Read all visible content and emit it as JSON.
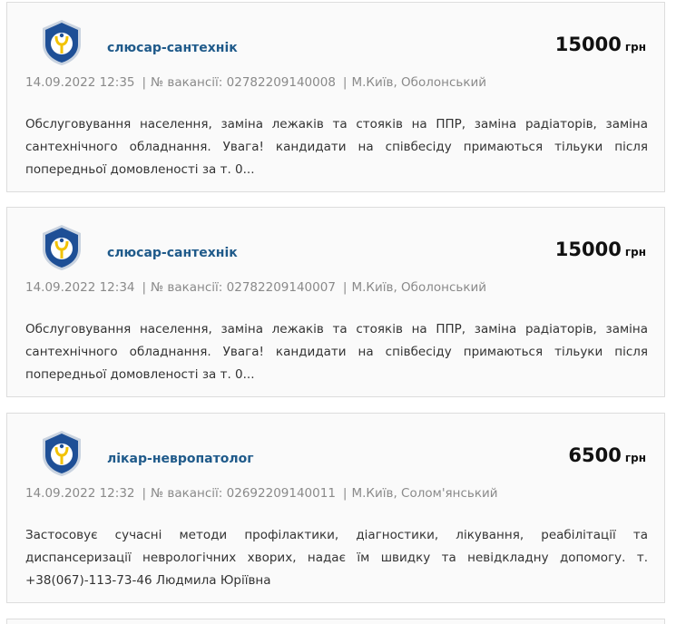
{
  "vacancies": [
    {
      "title": "слюсар-сантехнік",
      "salary": "15000",
      "currency": "грн",
      "date": "14.09.2022 12:35",
      "vacancy_label": "№ вакансії:",
      "vacancy_no": "02782209140008",
      "location": "М.Київ, Оболонський",
      "description": "Обслуговування населення, заміна лежаків та стояків на ППР, заміна радіаторів, заміна сантехнічного обладнання. Увага! кандидати на співбесіду примаються тільуки після попередньої домовленості за т. 0...",
      "logo_icon": "employment-center-shield-icon"
    },
    {
      "title": "слюсар-сантехнік",
      "salary": "15000",
      "currency": "грн",
      "date": "14.09.2022 12:34",
      "vacancy_label": "№ вакансії:",
      "vacancy_no": "02782209140007",
      "location": "М.Київ, Оболонський",
      "description": "Обслуговування населення, заміна лежаків та стояків на ППР, заміна радіаторів, заміна сантехнічного обладнання. Увага! кандидати на співбесіду примаються тільуки після попередньої домовленості за т. 0...",
      "logo_icon": "employment-center-shield-icon"
    },
    {
      "title": "лікар-невропатолог",
      "salary": "6500",
      "currency": "грн",
      "date": "14.09.2022 12:32",
      "vacancy_label": "№ вакансії:",
      "vacancy_no": "02692209140011",
      "location": "М.Київ, Солом'янський",
      "description": "Застосовує сучасні методи профілактики, діагностики, лікування, реабілітації та диспансеризації неврологічних хворих, надає їм швидку та невідкладну допомогу. т. +38(067)-113-73-46 Людмила Юріївна",
      "logo_icon": "employment-center-shield-icon"
    }
  ],
  "colors": {
    "title_link": "#1f5a8a",
    "logo_blue": "#1e4f96",
    "logo_yellow": "#f2c200",
    "meta_text": "#8a8a8a",
    "card_bg": "#fafafa",
    "card_border": "#dddddd"
  }
}
